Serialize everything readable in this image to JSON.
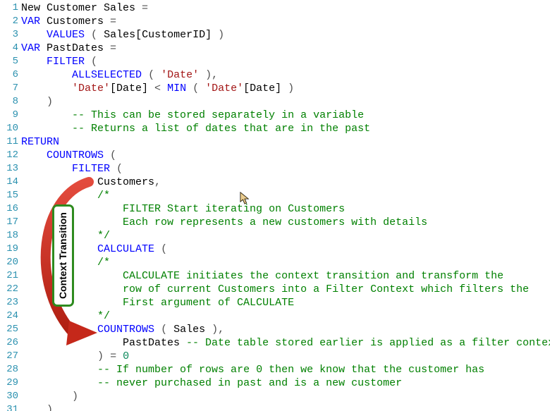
{
  "annotation": {
    "label": "Context Transition"
  },
  "lines": [
    {
      "n": 1,
      "tokens": [
        [
          "tbl",
          "New Customer Sales "
        ],
        [
          "op",
          "="
        ]
      ]
    },
    {
      "n": 2,
      "tokens": [
        [
          "kw",
          "VAR"
        ],
        [
          "tbl",
          " Customers "
        ],
        [
          "op",
          "="
        ]
      ]
    },
    {
      "n": 3,
      "tokens": [
        [
          "tbl",
          "    "
        ],
        [
          "fn",
          "VALUES"
        ],
        [
          "tbl",
          " "
        ],
        [
          "op",
          "("
        ],
        [
          "tbl",
          " Sales[CustomerID] "
        ],
        [
          "op",
          ")"
        ]
      ]
    },
    {
      "n": 4,
      "tokens": [
        [
          "kw",
          "VAR"
        ],
        [
          "tbl",
          " PastDates "
        ],
        [
          "op",
          "="
        ]
      ]
    },
    {
      "n": 5,
      "tokens": [
        [
          "tbl",
          "    "
        ],
        [
          "fn",
          "FILTER"
        ],
        [
          "tbl",
          " "
        ],
        [
          "op",
          "("
        ]
      ]
    },
    {
      "n": 6,
      "tokens": [
        [
          "tbl",
          "        "
        ],
        [
          "fn",
          "ALLSELECTED"
        ],
        [
          "tbl",
          " "
        ],
        [
          "op",
          "("
        ],
        [
          "tbl",
          " "
        ],
        [
          "str",
          "'Date'"
        ],
        [
          "tbl",
          " "
        ],
        [
          "op",
          ")"
        ],
        [
          "op",
          ","
        ]
      ]
    },
    {
      "n": 7,
      "tokens": [
        [
          "tbl",
          "        "
        ],
        [
          "str",
          "'Date'"
        ],
        [
          "tbl",
          "[Date] "
        ],
        [
          "op",
          "<"
        ],
        [
          "tbl",
          " "
        ],
        [
          "fn",
          "MIN"
        ],
        [
          "tbl",
          " "
        ],
        [
          "op",
          "("
        ],
        [
          "tbl",
          " "
        ],
        [
          "str",
          "'Date'"
        ],
        [
          "tbl",
          "[Date] "
        ],
        [
          "op",
          ")"
        ]
      ]
    },
    {
      "n": 8,
      "tokens": [
        [
          "tbl",
          "    "
        ],
        [
          "op",
          ")"
        ]
      ]
    },
    {
      "n": 9,
      "tokens": [
        [
          "tbl",
          "        "
        ],
        [
          "com",
          "-- This can be stored separately in a variable"
        ]
      ]
    },
    {
      "n": 10,
      "tokens": [
        [
          "tbl",
          "        "
        ],
        [
          "com",
          "-- Returns a list of dates that are in the past"
        ]
      ]
    },
    {
      "n": 11,
      "tokens": [
        [
          "kw",
          "RETURN"
        ]
      ]
    },
    {
      "n": 12,
      "tokens": [
        [
          "tbl",
          "    "
        ],
        [
          "fn",
          "COUNTROWS"
        ],
        [
          "tbl",
          " "
        ],
        [
          "op",
          "("
        ]
      ]
    },
    {
      "n": 13,
      "tokens": [
        [
          "tbl",
          "        "
        ],
        [
          "fn",
          "FILTER"
        ],
        [
          "tbl",
          " "
        ],
        [
          "op",
          "("
        ]
      ]
    },
    {
      "n": 14,
      "tokens": [
        [
          "tbl",
          "            Customers"
        ],
        [
          "op",
          ","
        ]
      ]
    },
    {
      "n": 15,
      "tokens": [
        [
          "tbl",
          "            "
        ],
        [
          "com",
          "/*"
        ]
      ]
    },
    {
      "n": 16,
      "tokens": [
        [
          "tbl",
          "                "
        ],
        [
          "com",
          "FILTER Start iterating on Customers"
        ]
      ]
    },
    {
      "n": 17,
      "tokens": [
        [
          "tbl",
          "                "
        ],
        [
          "com",
          "Each row represents a new customers with details"
        ]
      ]
    },
    {
      "n": 18,
      "tokens": [
        [
          "tbl",
          "            "
        ],
        [
          "com",
          "*/"
        ]
      ]
    },
    {
      "n": 19,
      "tokens": [
        [
          "tbl",
          "            "
        ],
        [
          "fn",
          "CALCULATE"
        ],
        [
          "tbl",
          " "
        ],
        [
          "op",
          "("
        ]
      ]
    },
    {
      "n": 20,
      "tokens": [
        [
          "tbl",
          "            "
        ],
        [
          "com",
          "/*"
        ]
      ]
    },
    {
      "n": 21,
      "tokens": [
        [
          "tbl",
          "                "
        ],
        [
          "com",
          "CALCULATE initiates the context transition and transform the"
        ]
      ]
    },
    {
      "n": 22,
      "tokens": [
        [
          "tbl",
          "                "
        ],
        [
          "com",
          "row of current Customers into a Filter Context which filters the"
        ]
      ]
    },
    {
      "n": 23,
      "tokens": [
        [
          "tbl",
          "                "
        ],
        [
          "com",
          "First argument of CALCULATE"
        ]
      ]
    },
    {
      "n": 24,
      "tokens": [
        [
          "tbl",
          "            "
        ],
        [
          "com",
          "*/"
        ]
      ]
    },
    {
      "n": 25,
      "tokens": [
        [
          "tbl",
          "            "
        ],
        [
          "fn",
          "COUNTROWS"
        ],
        [
          "tbl",
          " "
        ],
        [
          "op",
          "("
        ],
        [
          "tbl",
          " Sales "
        ],
        [
          "op",
          ")"
        ],
        [
          "op",
          ","
        ]
      ]
    },
    {
      "n": 26,
      "tokens": [
        [
          "tbl",
          "                PastDates "
        ],
        [
          "com",
          "-- Date table stored earlier is applied as a filter context"
        ]
      ]
    },
    {
      "n": 27,
      "tokens": [
        [
          "tbl",
          "            "
        ],
        [
          "op",
          ")"
        ],
        [
          "tbl",
          " "
        ],
        [
          "op",
          "="
        ],
        [
          "tbl",
          " "
        ],
        [
          "num",
          "0"
        ]
      ]
    },
    {
      "n": 28,
      "tokens": [
        [
          "tbl",
          "            "
        ],
        [
          "com",
          "-- If number of rows are 0 then we know that the customer has"
        ]
      ]
    },
    {
      "n": 29,
      "tokens": [
        [
          "tbl",
          "            "
        ],
        [
          "com",
          "-- never purchased in past and is a new customer"
        ]
      ]
    },
    {
      "n": 30,
      "tokens": [
        [
          "tbl",
          "        "
        ],
        [
          "op",
          ")"
        ]
      ]
    },
    {
      "n": 31,
      "tokens": [
        [
          "tbl",
          "    "
        ],
        [
          "op",
          ")"
        ]
      ]
    }
  ]
}
